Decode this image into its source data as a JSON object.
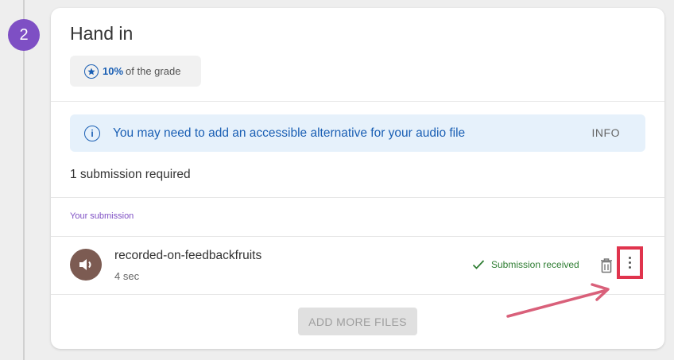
{
  "step": {
    "number": "2"
  },
  "card": {
    "title": "Hand in",
    "grade": {
      "percent": "10%",
      "suffix": "of the grade"
    },
    "info_banner": {
      "icon": "info-icon",
      "text": "You may need to add an accessible alternative for your audio file",
      "button_label": "INFO"
    },
    "requirement": "1 submission required",
    "submission_section_label": "Your submission",
    "submission": {
      "icon": "audio-speaker-icon",
      "file_name": "recorded-on-feedbackfruits",
      "duration": "4 sec",
      "status": "Submission received"
    },
    "add_more_label": "ADD MORE FILES"
  },
  "colors": {
    "accent_purple": "#7e4fc4",
    "link_blue": "#1a5fb4",
    "info_bg": "#e6f1fb",
    "success_green": "#2e7d32",
    "highlight_red": "#e0344d",
    "annotation_arrow": "#d9607a",
    "avatar_brown": "#7c5b52"
  }
}
